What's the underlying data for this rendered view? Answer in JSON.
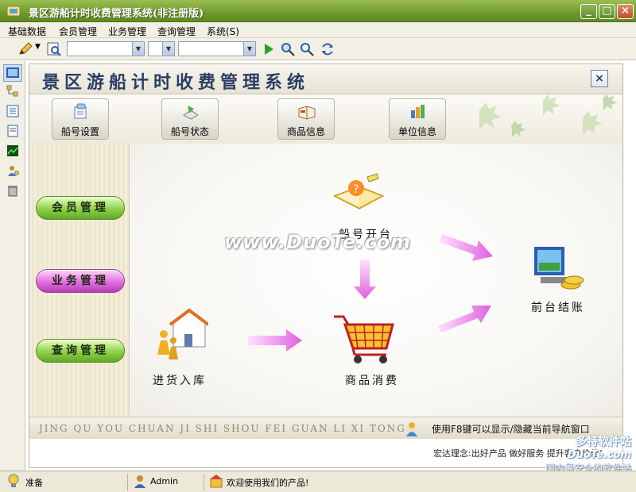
{
  "window": {
    "title": "景区游船计时收费管理系统(非注册版)",
    "min": "_",
    "max": "□",
    "close": "×"
  },
  "menu": [
    "基础数据",
    "会员管理",
    "业务管理",
    "查询管理",
    "系统(S)"
  ],
  "toolbar": {
    "combo1": "",
    "combo2": "",
    "combo3": ""
  },
  "app": {
    "title": "景区游船计时收费管理系统",
    "close": "×"
  },
  "quick": [
    {
      "label": "船号设置",
      "icon": "ship-settings-icon"
    },
    {
      "label": "船号状态",
      "icon": "ship-status-icon"
    },
    {
      "label": "商品信息",
      "icon": "product-info-icon"
    },
    {
      "label": "单位信息",
      "icon": "unit-info-icon"
    }
  ],
  "side": [
    "会员管理",
    "业务管理",
    "查询管理"
  ],
  "flow": {
    "open": "船号开台",
    "checkout": "前台结账",
    "stock": "进货入库",
    "consume": "商品消费"
  },
  "watermark": "www.DuoTe.com",
  "footer": {
    "pinyin": "JING QU YOU CHUAN JI SHI SHOU FEI GUAN LI XI TONG",
    "tip": "使用F8键可以显示/隐藏当前导航窗口",
    "slogan": "宏达理念:出好产品 做好服务 提升客户价值!"
  },
  "status": {
    "ready": "准备",
    "user": "Admin",
    "welcome": "欢迎使用我们的产品!"
  },
  "corner": {
    "line1": "多特软件站",
    "line2": "DuoTe.com",
    "line3": "国内最安全的软件站"
  },
  "colors": {
    "title_green": "#6f9a2c",
    "pink_button": "#e070e0",
    "green_button": "#8fd048"
  }
}
